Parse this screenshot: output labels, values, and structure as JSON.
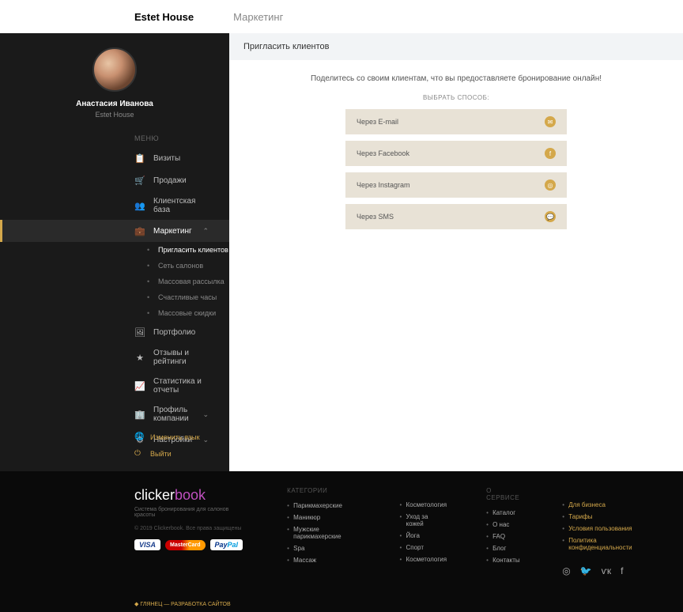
{
  "top": {
    "brand": "Estet House",
    "section": "Маркетинг"
  },
  "profile": {
    "name": "Анастасия Иванова",
    "company": "Estet House"
  },
  "menu": {
    "label": "МЕНЮ",
    "items": [
      {
        "icon": "calendar",
        "label": "Визиты"
      },
      {
        "icon": "cart",
        "label": "Продажи"
      },
      {
        "icon": "users",
        "label": "Клиентская база"
      },
      {
        "icon": "briefcase",
        "label": "Маркетинг",
        "active": true,
        "expanded": true
      },
      {
        "icon": "image",
        "label": "Портфолио"
      },
      {
        "icon": "star",
        "label": "Отзывы и рейтинги"
      },
      {
        "icon": "chart",
        "label": "Статистика и отчеты"
      },
      {
        "icon": "building",
        "label": "Профиль компании",
        "chevron": true
      },
      {
        "icon": "gear",
        "label": "Настройки",
        "chevron": true
      }
    ],
    "submenu": [
      {
        "label": "Пригласить клиентов",
        "active": true
      },
      {
        "label": "Сеть салонов"
      },
      {
        "label": "Массовая рассылка"
      },
      {
        "label": "Счастливые часы"
      },
      {
        "label": "Массовые скидки"
      }
    ],
    "bottom": [
      {
        "icon": "globe",
        "label": "Изменить язык"
      },
      {
        "icon": "power",
        "label": "Выйти"
      }
    ]
  },
  "content": {
    "title": "Пригласить клиентов",
    "desc": "Поделитесь со своим клиентам, что вы предоставляете бронирование онлайн!",
    "methodLabel": "ВЫБРАТЬ СПОСОБ:",
    "methods": [
      {
        "label": "Через E-mail",
        "icon": "✉"
      },
      {
        "label": "Через Facebook",
        "icon": "f"
      },
      {
        "label": "Через Instagram",
        "icon": "◎"
      },
      {
        "label": "Через SMS",
        "icon": "💬"
      }
    ]
  },
  "footer": {
    "brand1": "clicker",
    "brand2": "book",
    "tagline": "Система бронирования для салонов красоты",
    "copyright": "© 2019 Clickerbook. Все права защищены",
    "catTitle": "КАТЕГОРИИ",
    "cats1": [
      "Парикмахерские",
      "Маникюр",
      "Мужские парикмахерские",
      "Spa",
      "Массаж"
    ],
    "cats2": [
      "Косметология",
      "Уход за кожей",
      "Йога",
      "Спорт",
      "Косметология"
    ],
    "serviceTitle": "О СЕРВИСЕ",
    "service": [
      "Каталог",
      "О нас",
      "FAQ",
      "Блог",
      "Контакты"
    ],
    "right": [
      "Для бизнеса",
      "Тарифы",
      "Условия пользования",
      "Политика конфиденциальности"
    ],
    "dev": "ГЛЯНЕЦ — РАЗРАБОТКА САЙТОВ"
  },
  "icons": {
    "calendar": "📋",
    "cart": "🛒",
    "users": "👥",
    "briefcase": "💼",
    "image": "🖼",
    "star": "★",
    "chart": "📈",
    "building": "🏢",
    "gear": "⚙",
    "globe": "🌐",
    "power": "⏻"
  }
}
